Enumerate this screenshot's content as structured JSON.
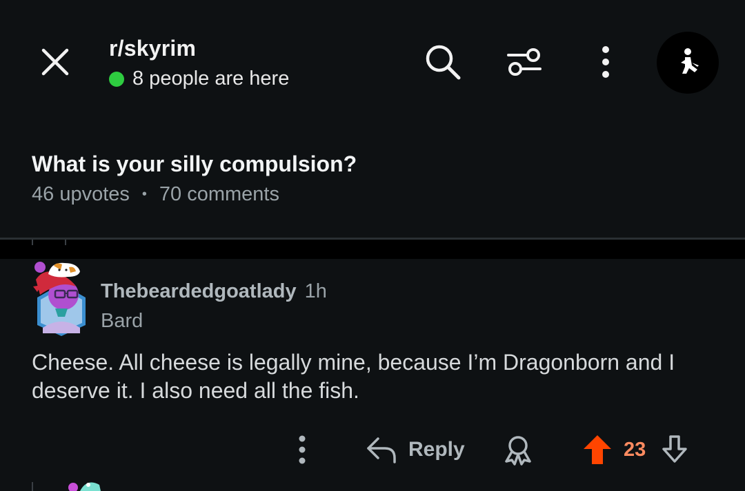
{
  "header": {
    "subreddit": "r/skyrim",
    "online_text": "8 people are here",
    "online_color": "#2ecc40",
    "icons": [
      "close-icon",
      "search-icon",
      "filter-icon",
      "more-vertical-icon",
      "user-avatar"
    ]
  },
  "post": {
    "title": "What is your silly compulsion?",
    "upvotes": "46 upvotes",
    "separator": "•",
    "comments": "70 comments"
  },
  "comment": {
    "username": "Thebeardedgoatlady",
    "time": "1h",
    "flair": "Bard",
    "body": "Cheese. All cheese is legally mine, because I’m Dragonborn and I deserve it. I also need all the fish.",
    "actions": {
      "reply_label": "Reply",
      "vote_count": "23",
      "upvote_color": "#ff4500",
      "icons": [
        "more-vertical-icon",
        "reply-icon",
        "award-icon",
        "upvote-icon",
        "downvote-icon"
      ]
    }
  }
}
